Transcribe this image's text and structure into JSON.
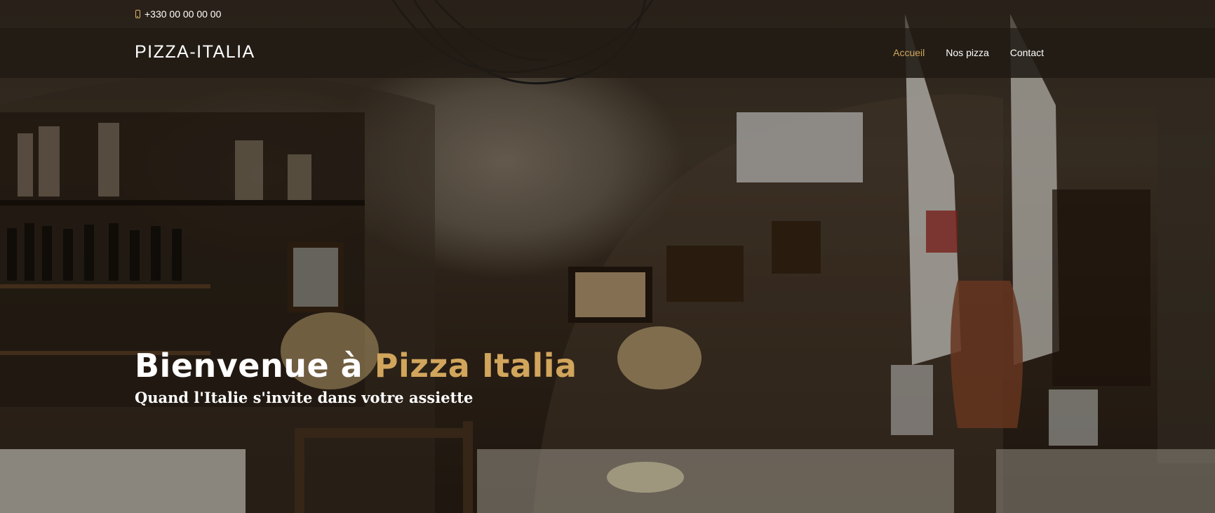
{
  "topbar": {
    "phone_icon": "mobile-phone-icon",
    "phone": "+330 00 00 00 00"
  },
  "navbar": {
    "brand": "PIZZA-ITALIA",
    "menu": [
      {
        "label": "Accueil",
        "active": true
      },
      {
        "label": "Nos pizza",
        "active": false
      },
      {
        "label": "Contact",
        "active": false
      }
    ]
  },
  "hero": {
    "title_prefix": "Bienvenue à",
    "title_accent": "Pizza Italia",
    "subtitle": "Quand l'Italie s'invite dans votre assiette"
  },
  "colors": {
    "accent": "#d1a55c",
    "nav_bg": "#211b15",
    "text": "#ffffff"
  }
}
